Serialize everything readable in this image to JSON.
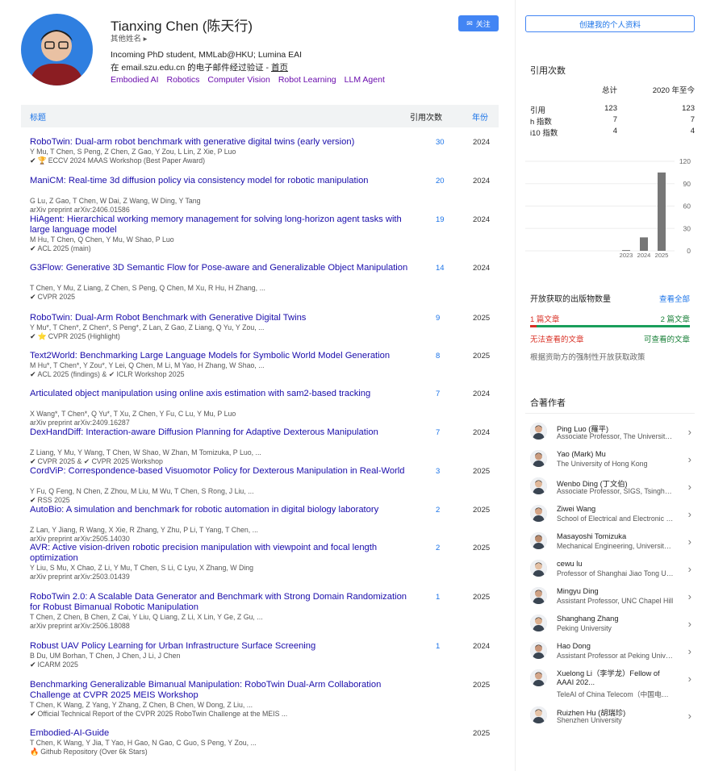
{
  "profile": {
    "name": "Tianxing Chen (陈天行)",
    "other_names": "其他姓名 ▸",
    "affiliation": "Incoming PhD student, MMLab@HKU; Lumina EAI",
    "verified_prefix": "在 email.szu.edu.cn 的电子邮件经过验证 - ",
    "homepage": "首页",
    "interests": [
      "Embodied AI",
      "Robotics",
      "Computer Vision",
      "Robot Learning",
      "LLM Agent"
    ],
    "follow_label": "关注"
  },
  "table": {
    "col_title": "标题",
    "col_cites": "引用次数",
    "col_year": "年份"
  },
  "papers": [
    {
      "title": "RoboTwin: Dual-arm robot benchmark with generative digital twins (early version)",
      "authors": "Y Mu, T Chen, S Peng, Z Chen, Z Gao, Y Zou, L Lin, Z Xie, P Luo",
      "venue": "ECCV 2024 MAAS Workshop (Best Paper Award)",
      "icon": "trophy-icon",
      "cites": "30",
      "year": "2024"
    },
    {
      "title": "ManiCM: Real-time 3d diffusion policy via consistency model for robotic manipulation",
      "authors": "G Lu, Z Gao, T Chen, W Dai, Z Wang, W Ding, Y Tang",
      "venue": "arXiv preprint arXiv:2406.01586",
      "icon": "",
      "cites": "20",
      "year": "2024"
    },
    {
      "title": "HiAgent: Hierarchical working memory management for solving long-horizon agent tasks with large language model",
      "authors": "M Hu, T Chen, Q Chen, Y Mu, W Shao, P Luo",
      "venue": "ACL 2025 (main)",
      "icon": "check-icon",
      "cites": "19",
      "year": "2024"
    },
    {
      "title": "G3Flow: Generative 3D Semantic Flow for Pose-aware and Generalizable Object Manipulation",
      "authors": "T Chen, Y Mu, Z Liang, Z Chen, S Peng, Q Chen, M Xu, R Hu, H Zhang, ...",
      "venue": "CVPR 2025",
      "icon": "check-icon",
      "cites": "14",
      "year": "2024"
    },
    {
      "title": "RoboTwin: Dual-Arm Robot Benchmark with Generative Digital Twins",
      "authors": "Y Mu*, T Chen*, Z Chen*, S Peng*, Z Lan, Z Gao, Z Liang, Q Yu, Y Zou, ...",
      "venue": "CVPR 2025 (Highlight)",
      "icon": "star-icon",
      "cites": "9",
      "year": "2025"
    },
    {
      "title": "Text2World: Benchmarking Large Language Models for Symbolic World Model Generation",
      "authors": "M Hu*, T Chen*, Y Zou*, Y Lei, Q Chen, M Li, M Yao, H Zhang, W Shao, ...",
      "venue": "ACL 2025 (findings) & ✔ ICLR Workshop 2025",
      "icon": "check-icon",
      "cites": "8",
      "year": "2025"
    },
    {
      "title": "Articulated object manipulation using online axis estimation with sam2-based tracking",
      "authors": "X Wang*, T Chen*, Q Yu*, T Xu, Z Chen, Y Fu, C Lu, Y Mu, P Luo",
      "venue": "arXiv preprint arXiv:2409.16287",
      "icon": "",
      "cites": "7",
      "year": "2024"
    },
    {
      "title": "DexHandDiff: Interaction-aware Diffusion Planning for Adaptive Dexterous Manipulation",
      "authors": "Z Liang, Y Mu, Y Wang, T Chen, W Shao, W Zhan, M Tomizuka, P Luo, ...",
      "venue": "CVPR 2025 & ✔ CVPR 2025 Workshop",
      "icon": "check-icon",
      "cites": "7",
      "year": "2024"
    },
    {
      "title": "CordViP: Correspondence-based Visuomotor Policy for Dexterous Manipulation in Real-World",
      "authors": "Y Fu, Q Feng, N Chen, Z Zhou, M Liu, M Wu, T Chen, S Rong, J Liu, ...",
      "venue": "RSS 2025",
      "icon": "check-icon",
      "cites": "3",
      "year": "2025"
    },
    {
      "title": "AutoBio: A simulation and benchmark for robotic automation in digital biology laboratory",
      "authors": "Z Lan, Y Jiang, R Wang, X Xie, R Zhang, Y Zhu, P Li, T Yang, T Chen, ...",
      "venue": "arXiv preprint arXiv:2505.14030",
      "icon": "",
      "cites": "2",
      "year": "2025"
    },
    {
      "title": "AVR: Active vision-driven robotic precision manipulation with viewpoint and focal length optimization",
      "authors": "Y Liu, S Mu, X Chao, Z Li, Y Mu, T Chen, S Li, C Lyu, X Zhang, W Ding",
      "venue": "arXiv preprint arXiv:2503.01439",
      "icon": "",
      "cites": "2",
      "year": "2025"
    },
    {
      "title": "RoboTwin 2.0: A Scalable Data Generator and Benchmark with Strong Domain Randomization for Robust Bimanual Robotic Manipulation",
      "authors": "T Chen, Z Chen, B Chen, Z Cai, Y Liu, Q Liang, Z Li, X Lin, Y Ge, Z Gu, ...",
      "venue": "arXiv preprint arXiv:2506.18088",
      "icon": "",
      "cites": "1",
      "year": "2025"
    },
    {
      "title": "Robust UAV Policy Learning for Urban Infrastructure Surface Screening",
      "authors": "B Du, UM Borhan, T Chen, J Chen, J Li, J Chen",
      "venue": "ICARM 2025",
      "icon": "check-icon",
      "cites": "1",
      "year": "2024"
    },
    {
      "title": "Benchmarking Generalizable Bimanual Manipulation: RoboTwin Dual-Arm Collaboration Challenge at CVPR 2025 MEIS Workshop",
      "authors": "T Chen, K Wang, Z Yang, Y Zhang, Z Chen, B Chen, W Dong, Z Liu, ...",
      "venue": "Official Technical Report of the CVPR 2025 RoboTwin Challenge at the MEIS ...",
      "icon": "check-icon",
      "cites": "",
      "year": "2025"
    },
    {
      "title": "Embodied-AI-Guide",
      "authors": "T Chen, K Wang, Y Jia, T Yao, H Gao, N Gao, C Guo, S Peng, Y Zou, ...",
      "venue": "Github Repository (Over 6k Stars)",
      "icon": "fire-icon",
      "cites": "",
      "year": "2025"
    }
  ],
  "sidebar": {
    "create_profile": "创建我的个人资料",
    "cited_by_title": "引用次数",
    "col_all": "总计",
    "col_since": "2020 年至今",
    "stats": [
      {
        "label": "引用",
        "all": "123",
        "since": "123"
      },
      {
        "label": "h 指数",
        "all": "7",
        "since": "7"
      },
      {
        "label": "i10 指数",
        "all": "4",
        "since": "4"
      }
    ],
    "oa_title": "开放获取的出版物数量",
    "oa_view_all": "查看全部",
    "oa_left_count": "1 篇文章",
    "oa_right_count": "2 篇文章",
    "oa_left_label": "无法查看的文章",
    "oa_right_label": "可查看的文章",
    "oa_mandate": "根据资助方的强制性开放获取政策",
    "oa_available_fraction": 0.667,
    "coauthors_title": "合著作者",
    "coauthors": [
      {
        "name": "Ping Luo (羅平)",
        "affil": "Associate Professor, The University of Hong Kong"
      },
      {
        "name": "Yao (Mark) Mu",
        "affil": "The University of Hong Kong"
      },
      {
        "name": "Wenbo Ding (丁文伯)",
        "affil": "Associate Professor, SIGS, Tsinghua University"
      },
      {
        "name": "Ziwei Wang",
        "affil": "School of Electrical and Electronic Engineering"
      },
      {
        "name": "Masayoshi Tomizuka",
        "affil": "Mechanical Engineering, University of California"
      },
      {
        "name": "cewu lu",
        "affil": "Professor of Shanghai Jiao Tong University"
      },
      {
        "name": "Mingyu Ding",
        "affil": "Assistant Professor, UNC Chapel Hill"
      },
      {
        "name": "Shanghang Zhang",
        "affil": "Peking University"
      },
      {
        "name": "Hao Dong",
        "affil": "Assistant Professor at Peking University"
      },
      {
        "name": "Xuelong Li（李学龙）Fellow of AAAI 202...",
        "affil": "TeleAI of China Telecom（中国电信）"
      },
      {
        "name": "Ruizhen Hu (胡瑞珍)",
        "affil": "Shenzhen University"
      }
    ]
  },
  "chart_data": {
    "type": "bar",
    "categories": [
      "2023",
      "2024",
      "2025"
    ],
    "values": [
      1,
      18,
      105
    ],
    "ylim": [
      0,
      120
    ],
    "yticks": [
      "120",
      "90",
      "60",
      "30",
      "0"
    ],
    "bar_color": "#777777"
  }
}
